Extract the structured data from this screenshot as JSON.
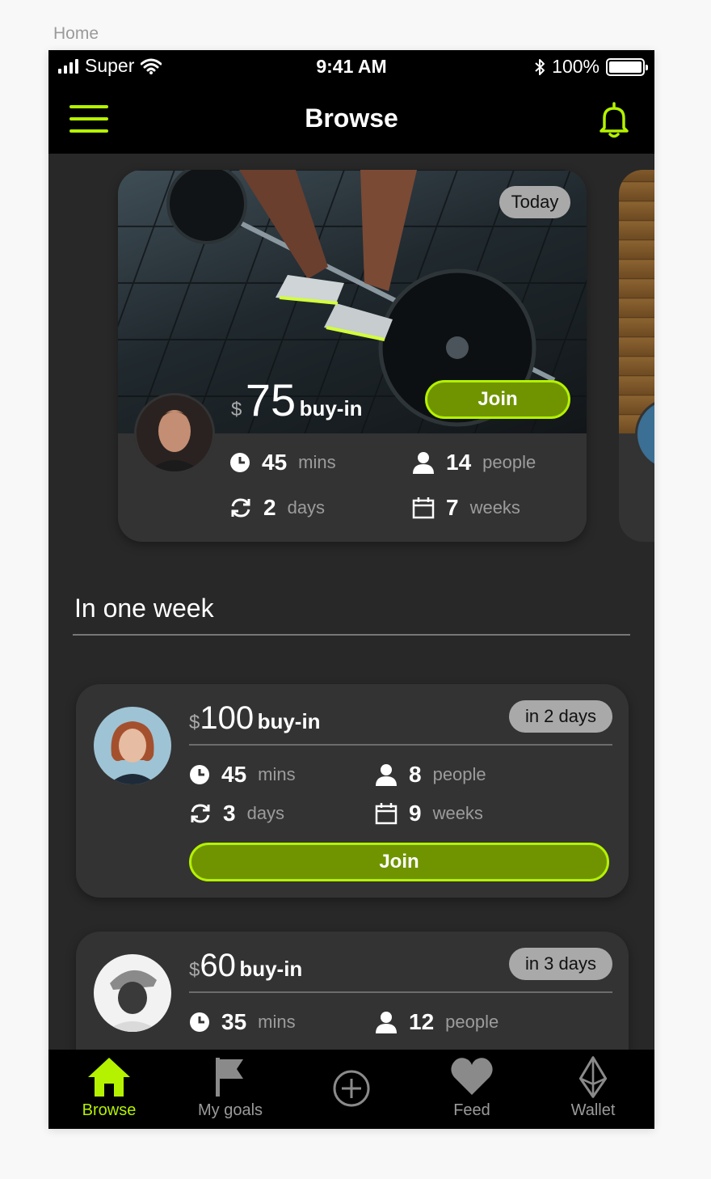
{
  "artboard_label": "Home",
  "status_bar": {
    "carrier": "Super",
    "time": "9:41 AM",
    "battery": "100%"
  },
  "nav": {
    "title": "Browse",
    "menu_icon": "hamburger-icon",
    "bell_icon": "bell-icon"
  },
  "colors": {
    "accent": "#b4f200",
    "button_fill": "#6f9400",
    "card": "#333333",
    "background": "#282828",
    "bar": "#000000"
  },
  "featured": {
    "badge": "Today",
    "currency": "$",
    "amount": "75",
    "buy_in_label": "buy-in",
    "join_label": "Join",
    "duration": {
      "value": "45",
      "unit": "mins"
    },
    "people": {
      "value": "14",
      "unit": "people"
    },
    "frequency": {
      "value": "2",
      "unit": "days"
    },
    "length": {
      "value": "7",
      "unit": "weeks"
    }
  },
  "section": {
    "title": "In one week"
  },
  "cards": [
    {
      "badge": "in 2 days",
      "currency": "$",
      "amount": "100",
      "buy_in_label": "buy-in",
      "join_label": "Join",
      "duration": {
        "value": "45",
        "unit": "mins"
      },
      "people": {
        "value": "8",
        "unit": "people"
      },
      "frequency": {
        "value": "3",
        "unit": "days"
      },
      "length": {
        "value": "9",
        "unit": "weeks"
      }
    },
    {
      "badge": "in 3 days",
      "currency": "$",
      "amount": "60",
      "buy_in_label": "buy-in",
      "duration": {
        "value": "35",
        "unit": "mins"
      },
      "people": {
        "value": "12",
        "unit": "people"
      }
    }
  ],
  "tabs": [
    {
      "label": "Browse",
      "icon": "home-icon",
      "active": true
    },
    {
      "label": "My goals",
      "icon": "flag-icon",
      "active": false
    },
    {
      "label": "",
      "icon": "add-circle-icon",
      "active": false
    },
    {
      "label": "Feed",
      "icon": "heart-icon",
      "active": false
    },
    {
      "label": "Wallet",
      "icon": "ethereum-icon",
      "active": false
    }
  ]
}
